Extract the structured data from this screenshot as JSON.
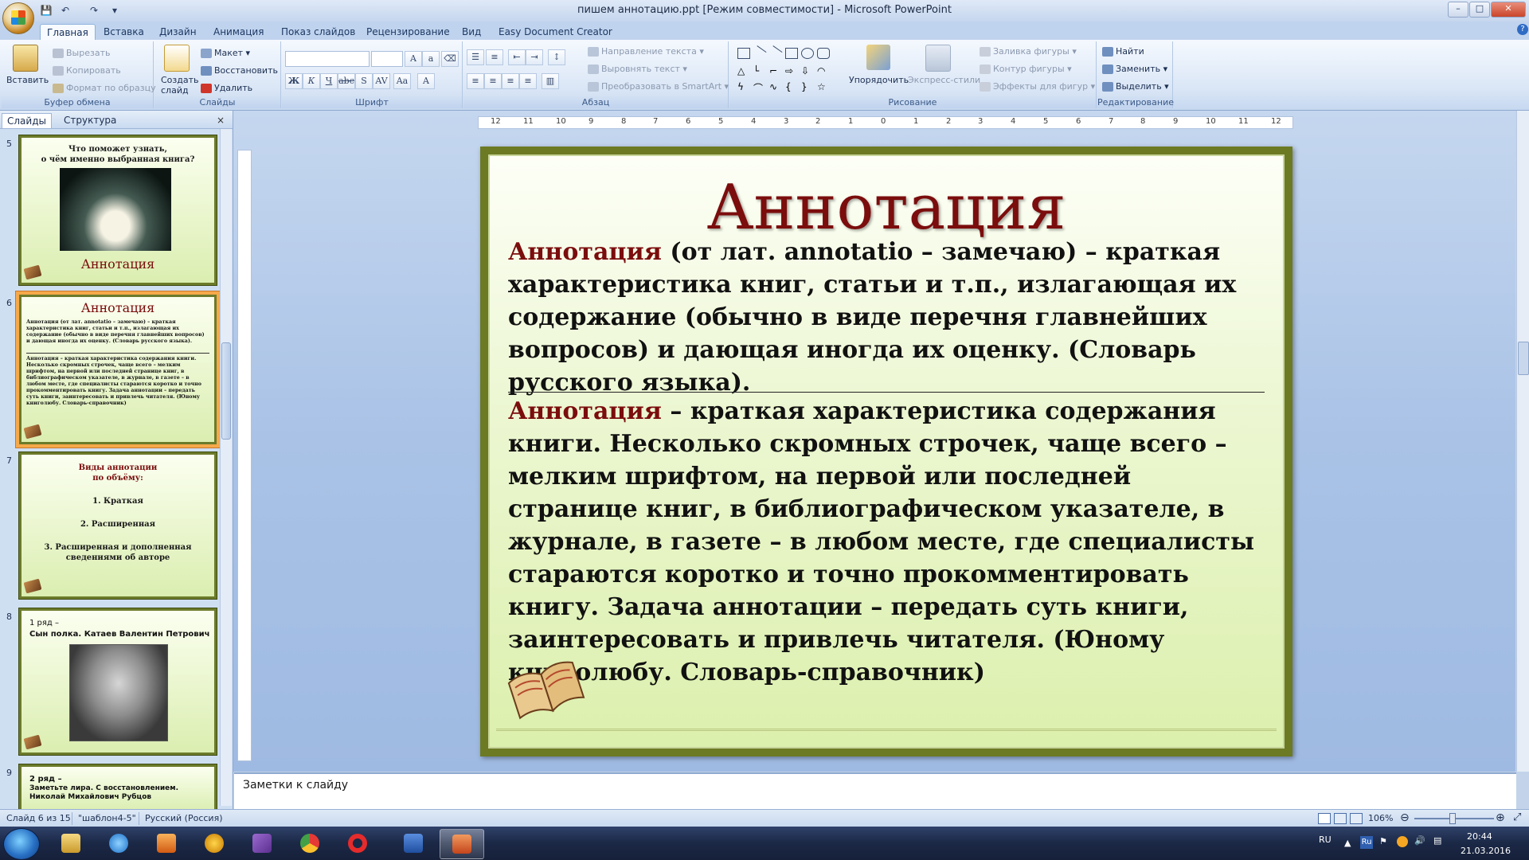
{
  "window": {
    "title": "пишем аннотацию.ppt [Режим совместимости] - Microsoft PowerPoint",
    "controls": [
      "–",
      "□",
      "✕"
    ]
  },
  "ribbon": {
    "tabs": [
      "Главная",
      "Вставка",
      "Дизайн",
      "Анимация",
      "Показ слайдов",
      "Рецензирование",
      "Вид",
      "Easy Document Creator"
    ],
    "active_tab": "Главная",
    "clipboard": {
      "title": "Буфер обмена",
      "paste": "Вставить",
      "cut": "Вырезать",
      "copy": "Копировать",
      "format_painter": "Формат по образцу"
    },
    "slides": {
      "title": "Слайды",
      "new_slide": "Создать слайд",
      "layout": "Макет",
      "reset": "Восстановить",
      "delete": "Удалить"
    },
    "font": {
      "title": "Шрифт"
    },
    "paragraph": {
      "title": "Абзац",
      "text_direction": "Направление текста",
      "align_text": "Выровнять текст",
      "convert_smartart": "Преобразовать в SmartArt"
    },
    "drawing": {
      "title": "Рисование",
      "arrange": "Упорядочить",
      "quick_styles": "Экспресс-стили",
      "shape_fill": "Заливка фигуры",
      "shape_outline": "Контур фигуры",
      "shape_effects": "Эффекты для фигур"
    },
    "editing": {
      "title": "Редактирование",
      "find": "Найти",
      "replace": "Заменить",
      "select": "Выделить"
    }
  },
  "left_panel": {
    "tabs": [
      "Слайды",
      "Структура"
    ],
    "close": "×",
    "thumbnails": [
      {
        "num": "5",
        "title": "Что поможет узнать,\nо чём именно выбранная книга?",
        "caption": "Аннотация"
      },
      {
        "num": "6",
        "title": "Аннотация",
        "body1": "Аннотация (от лат. annotatio – замечаю) – краткая характеристика книг, статьи и т.п., излагающая их содержание (обычно в виде перечня главнейших вопросов) и дающая иногда их оценку. (Словарь русского языка).",
        "body2": "Аннотация – краткая характеристика содержания книги. Несколько скромных строчек, чаще всего – мелким шрифтом, на первой или последней странице книг, в библиографическом указателе, в журнале, в газете – в любом месте, где специалисты стараются коротко и точно прокомментировать книгу. Задача аннотации – передать суть книги, заинтересовать и привлечь читателя. (Юному книголюбу. Словарь-справочник)"
      },
      {
        "num": "7",
        "title": "Виды аннотации\nпо объёму:",
        "items": [
          "1. Краткая",
          "2. Расширенная",
          "3. Расширенная и дополненная сведениями об авторе"
        ]
      },
      {
        "num": "8",
        "line1": "1 ряд –",
        "line2": "Сын полка. Катаев Валентин Петрович"
      },
      {
        "num": "9",
        "line1": "2 ряд –",
        "line2": "Заметьте лира. С восстановлением. Николай Михайлович Рубцов"
      }
    ]
  },
  "ruler": {
    "h_ticks": [
      "12",
      "11",
      "10",
      "9",
      "8",
      "7",
      "6",
      "5",
      "4",
      "3",
      "2",
      "1",
      "0",
      "1",
      "2",
      "3",
      "4",
      "5",
      "6",
      "7",
      "8",
      "9",
      "10",
      "11",
      "12"
    ]
  },
  "slide": {
    "title": "Аннотация",
    "para1_term": "Аннотация",
    "para1_rest": " (от лат. annotatio – замечаю) – краткая характеристика книг, статьи и т.п., излагающая их содержание (обычно в виде перечня главнейших вопросов) и дающая иногда их оценку. (Словарь русского языка).",
    "para2_term": "Аннотация",
    "para2_rest": " – краткая характеристика содержания книги. Несколько скромных строчек, чаще всего – мелким шрифтом, на первой или последней странице книг, в библиографическом указателе, в журнале, в газете – в любом месте, где специалисты стараются коротко и точно прокомментировать книгу. Задача аннотации – передать суть книги, заинтересовать и привлечь читателя. (Юному книголюбу. Словарь-справочник)"
  },
  "notes": {
    "placeholder": "Заметки к слайду"
  },
  "status": {
    "slide_of": "Слайд 6 из 15",
    "theme": "\"шаблон4-5\"",
    "language": "Русский (Россия)",
    "zoom": "106%"
  },
  "taskbar": {
    "lang": "RU",
    "time": "20:44",
    "date": "21.03.2016"
  },
  "colors": {
    "accent_red": "#7b0d0d",
    "slide_border": "#6c7a23",
    "selection": "#f6a94a"
  }
}
